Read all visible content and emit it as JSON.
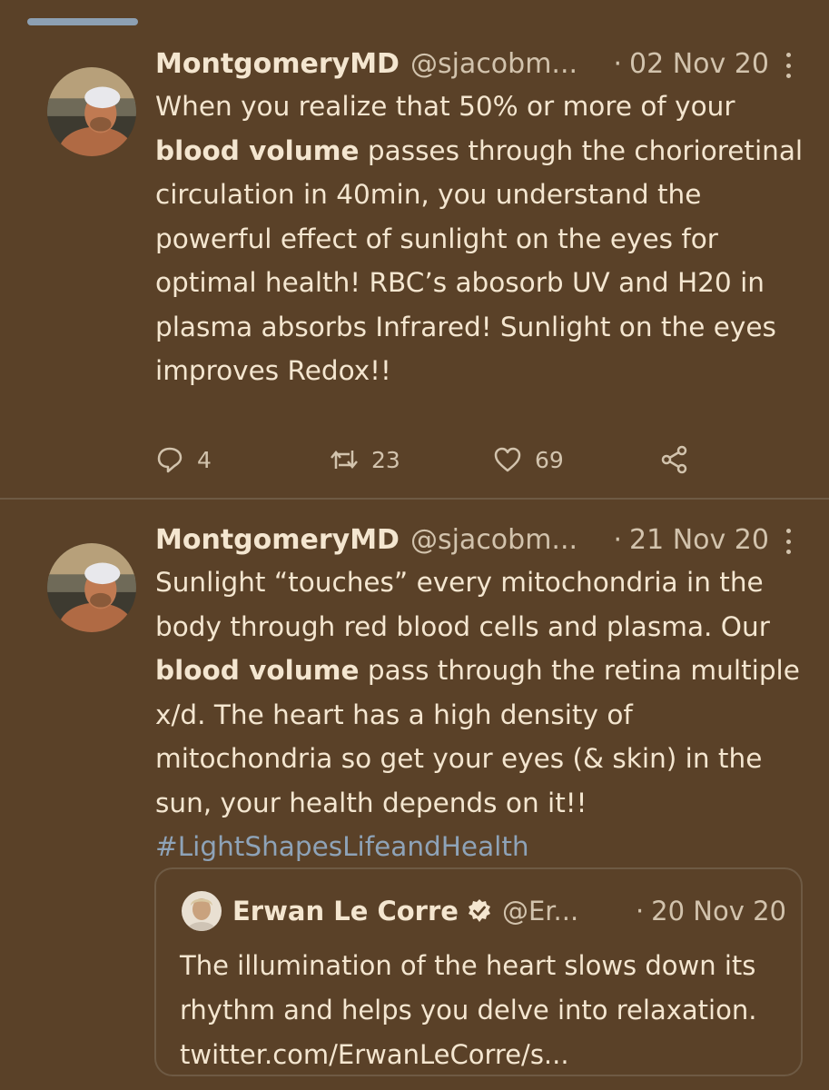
{
  "tweets": [
    {
      "author": "MontgomeryMD",
      "handle": "@sjacobm...",
      "separator": "·",
      "date": "02 Nov 20",
      "text_before": "When you realize that 50% or more of your ",
      "text_bold": "blood volume",
      "text_after": " passes through the chorioretinal circulation in 40min, you understand the powerful effect of sunlight on the eyes for optimal health! RBC’s abosorb UV and H20 in plasma absorbs Infrared! Sunlight on the eyes improves Redox!!",
      "replies": "4",
      "retweets": "23",
      "likes": "69"
    },
    {
      "author": "MontgomeryMD",
      "handle": "@sjacobm...",
      "separator": "·",
      "date": "21 Nov 20",
      "text_before": "Sunlight “touches” every mitochondria in the body through red blood cells and plasma. Our ",
      "text_bold": "blood volume",
      "text_after": " pass through the retina multiple x/d. The heart has a high density of mitochondria so get your eyes (& skin) in the sun, your health depends on it!! ",
      "hashtag": "#LightShapesLifeandHealth",
      "quoted": {
        "author": "Erwan Le Corre",
        "handle": "@Er...",
        "separator": "·",
        "date": "20 Nov 20",
        "text": "The illumination of the heart slows down its rhythm and helps you delve into relaxation. twitter.com/ErwanLeCorre/s..."
      }
    }
  ],
  "colors": {
    "background": "#5a4128",
    "text": "#f4e6d0",
    "muted": "#d2c3ad",
    "hashtag": "#8ea3b8",
    "divider": "#6e5a44"
  },
  "icons": [
    "reply-icon",
    "retweet-icon",
    "like-icon",
    "share-icon",
    "more-icon",
    "verified-icon"
  ]
}
